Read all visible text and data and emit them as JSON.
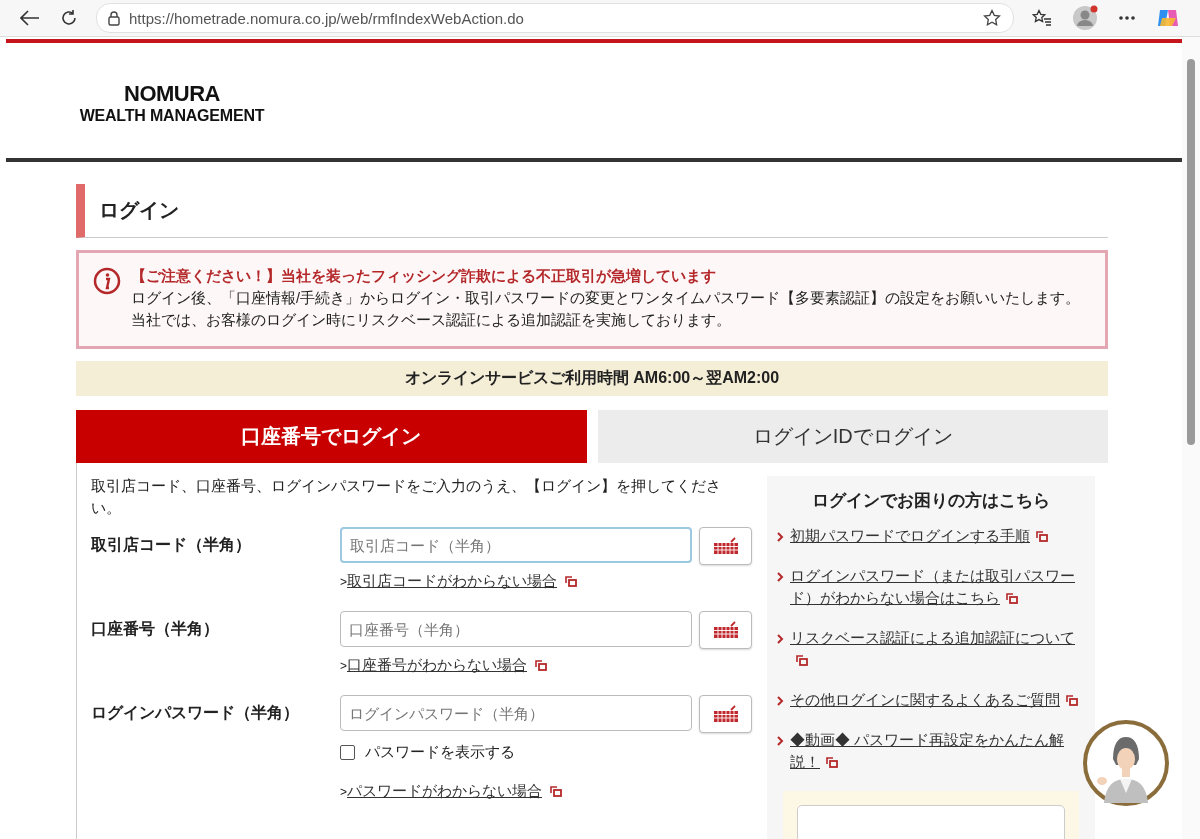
{
  "browser": {
    "url": "https://hometrade.nomura.co.jp/web/rmfIndexWebAction.do"
  },
  "logo": {
    "line1": "NOMURA",
    "line2": "WEALTH MANAGEMENT"
  },
  "heading": "ログイン",
  "notice": {
    "title": "【ご注意ください！】当社を装ったフィッシング詐欺による不正取引が急増しています",
    "lines": [
      "ログイン後、「口座情報/手続き」からログイン・取引パスワードの変更とワンタイムパスワード【多要素認証】の設定をお願いいたします。",
      "当社では、お客様のログイン時にリスクベース認証による追加認証を実施しております。"
    ]
  },
  "hours": "オンラインサービスご利用時間 AM6:00～翌AM2:00",
  "tabs": [
    {
      "label": "口座番号でログイン",
      "selected": true
    },
    {
      "label": "ログインIDでログイン",
      "selected": false
    }
  ],
  "instructions": "取引店コード、口座番号、ログインパスワードをご入力のうえ、【ログイン】を押してください。",
  "fields": [
    {
      "label": "取引店コード（半角）",
      "placeholder": "取引店コード（半角）",
      "focused": true,
      "link_prefix": ">",
      "link": "取引店コードがわからない場合"
    },
    {
      "label": "口座番号（半角）",
      "placeholder": "口座番号（半角）",
      "focused": false,
      "link_prefix": ">",
      "link": "口座番号がわからない場合"
    },
    {
      "label": "ログインパスワード（半角）",
      "placeholder": "ログインパスワード（半角）",
      "focused": false,
      "show_password": {
        "label": "パスワードを表示する",
        "checked": false
      },
      "link_prefix": ">",
      "link": "パスワードがわからない場合"
    }
  ],
  "help": {
    "title": "ログインでお困りの方はこちら",
    "links": [
      "初期パスワードでログインする手順",
      "ログインパスワード（または取引パスワード）がわからない場合はこちら",
      "リスクベース認証による追加認証について",
      "その他ログインに関するよくあるご質問",
      "◆動画◆ パスワード再設定をかんたん解説！"
    ]
  }
}
